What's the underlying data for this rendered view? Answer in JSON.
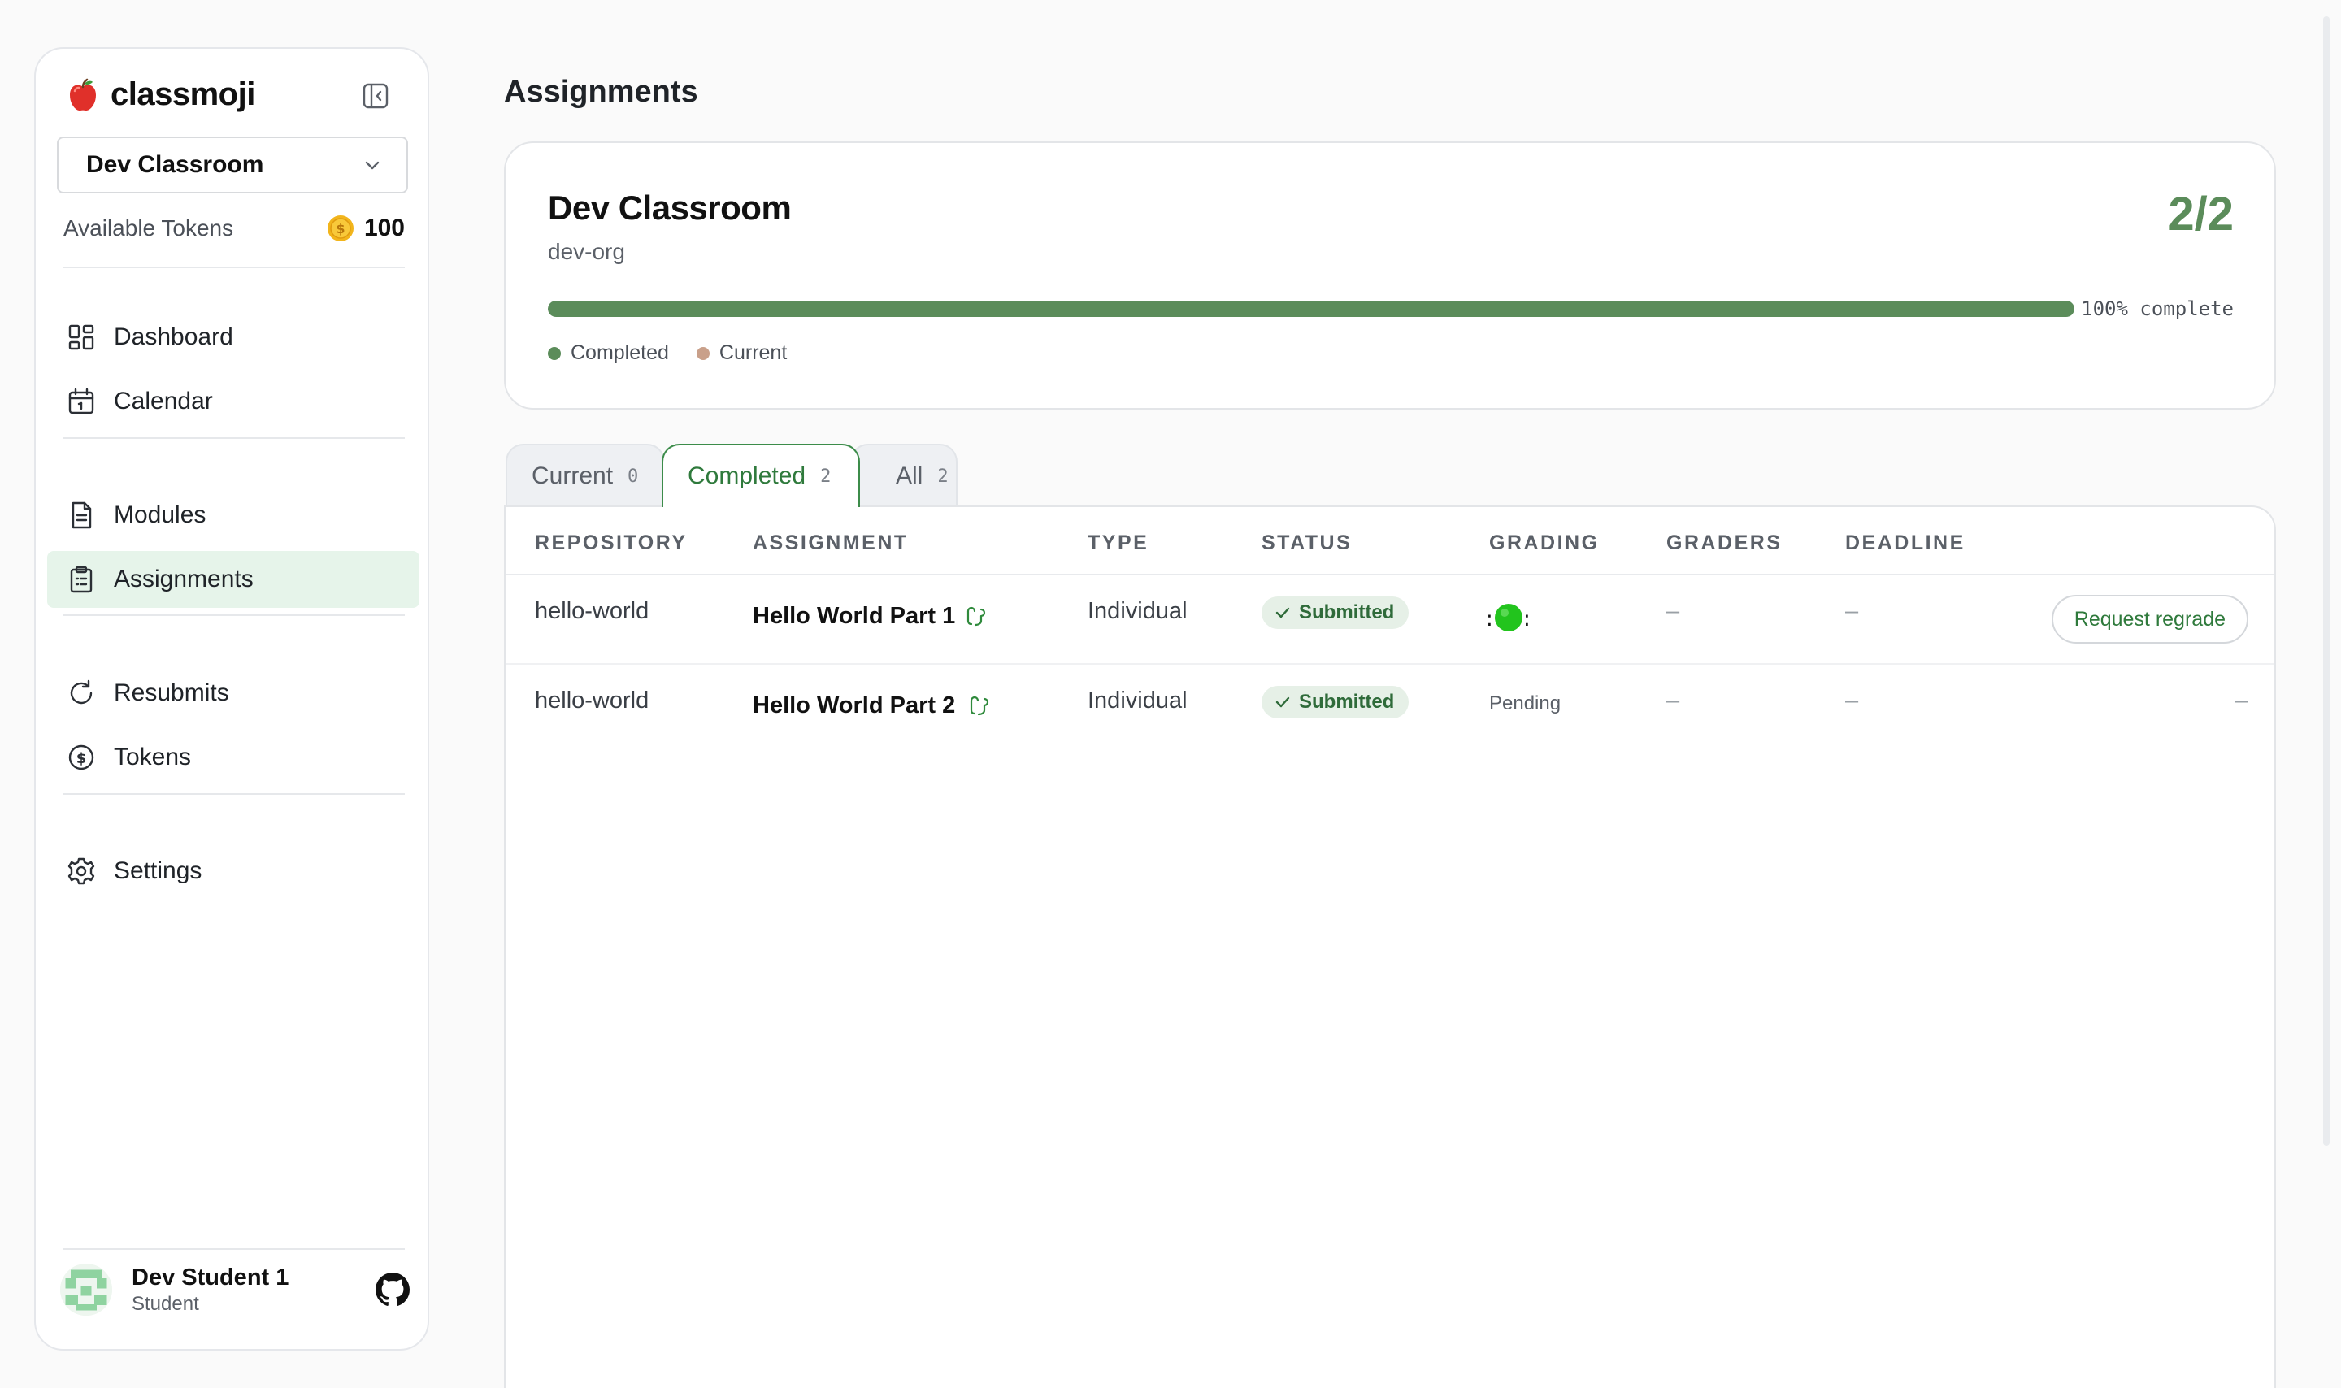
{
  "sidebar": {
    "brand": "classmoji",
    "classroom": "Dev Classroom",
    "tokens_label": "Available Tokens",
    "tokens_value": "100",
    "nav": {
      "dashboard": "Dashboard",
      "calendar": "Calendar",
      "modules": "Modules",
      "assignments": "Assignments",
      "resubmits": "Resubmits",
      "tokens": "Tokens",
      "settings": "Settings"
    },
    "active_item": "Assignments",
    "user": {
      "name": "Dev Student 1",
      "role": "Student"
    }
  },
  "page": {
    "title": "Assignments"
  },
  "summary": {
    "classroom_name": "Dev Classroom",
    "org": "dev-org",
    "count": "2/2",
    "progress_fraction": 1.0,
    "progress_text": "100% complete",
    "legend": {
      "completed": "Completed",
      "current": "Current"
    },
    "colors": {
      "completed": "#5b8c5a",
      "current": "#c9a08a"
    }
  },
  "tabs": {
    "current": {
      "label": "Current",
      "count": "0"
    },
    "completed": {
      "label": "Completed",
      "count": "2"
    },
    "all": {
      "label": "All",
      "count": "2"
    },
    "active": "Completed"
  },
  "table": {
    "headers": {
      "repository": "Repository",
      "assignment": "Assignment",
      "type": "Type",
      "status": "Status",
      "grading": "Grading",
      "graders": "Graders",
      "deadline": "Deadline"
    },
    "rows": [
      {
        "repository": "hello-world",
        "assignment": "Hello World Part 1",
        "type": "Individual",
        "status": "Submitted",
        "grading_emoji": "green-circle",
        "graders": "–",
        "deadline": "–",
        "action": "Request regrade"
      },
      {
        "repository": "hello-world",
        "assignment": "Hello World Part 2",
        "type": "Individual",
        "status": "Submitted",
        "grading": "Pending",
        "graders": "–",
        "deadline": "–",
        "action": "–"
      }
    ]
  },
  "colors": {
    "accent_green": "#2f7a3c",
    "progress_green": "#5b8c5a",
    "active_nav_bg": "#e6f4ea",
    "badge_bg": "#e6f0e7"
  }
}
